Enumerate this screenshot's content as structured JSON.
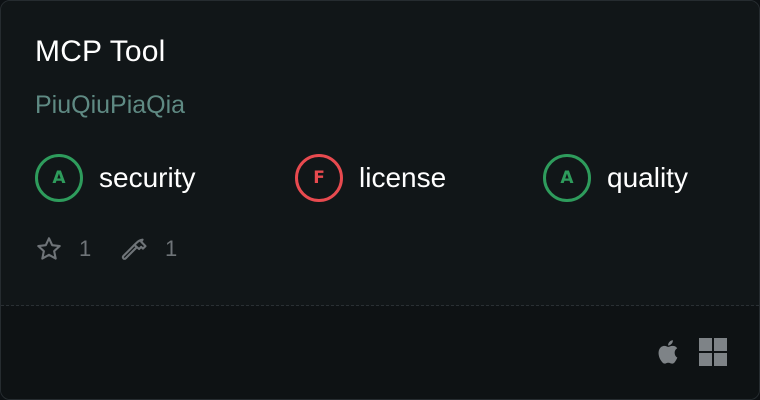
{
  "tool": {
    "title": "MCP Tool",
    "author": "PiuQiuPiaQia"
  },
  "grades": [
    {
      "letter": "A",
      "label": "security",
      "status": "pass"
    },
    {
      "letter": "F",
      "label": "license",
      "status": "fail"
    },
    {
      "letter": "A",
      "label": "quality",
      "status": "pass"
    }
  ],
  "stats": {
    "stars": "1",
    "tools": "1"
  },
  "icons": {
    "star": "star-icon",
    "tools": "hammer-icon",
    "platforms": [
      "apple-icon",
      "windows-icon"
    ]
  },
  "colors": {
    "pass": "#2e9c5c",
    "fail": "#e84a4f",
    "author": "#5f8a83"
  }
}
